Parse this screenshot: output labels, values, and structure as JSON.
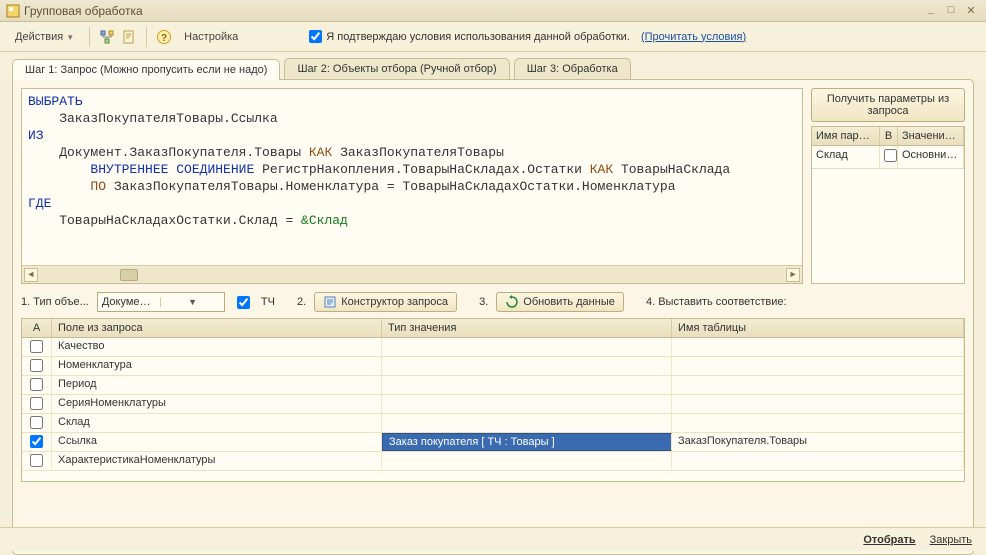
{
  "window": {
    "title": "Групповая обработка"
  },
  "toolbar": {
    "actions_label": "Действия",
    "settings_label": "Настройка",
    "confirm_label": "Я подтверждаю условия использования данной обработки.",
    "confirm_link": "(Прочитать условия)",
    "confirm_checked": true
  },
  "tabs": [
    {
      "label": "Шаг 1: Запрос (Можно пропусить если не надо)",
      "active": true
    },
    {
      "label": "Шаг 2: Объекты отбора (Ручной отбор)",
      "active": false
    },
    {
      "label": "Шаг 3: Обработка",
      "active": false
    }
  ],
  "query": {
    "tokens": [
      [
        {
          "t": "ВЫБРАТЬ",
          "c": "blue"
        }
      ],
      [
        {
          "t": "    ЗаказПокупателяТовары.Ссылка",
          "c": ""
        }
      ],
      [
        {
          "t": "ИЗ",
          "c": "blue"
        }
      ],
      [
        {
          "t": "    Документ.ЗаказПокупателя.Товары ",
          "c": ""
        },
        {
          "t": "КАК",
          "c": "brown"
        },
        {
          "t": " ЗаказПокупателяТовары",
          "c": ""
        }
      ],
      [
        {
          "t": "        ",
          "c": ""
        },
        {
          "t": "ВНУТРЕННЕЕ",
          "c": "blue"
        },
        {
          "t": " ",
          "c": ""
        },
        {
          "t": "СОЕДИНЕНИЕ",
          "c": "blue"
        },
        {
          "t": " РегистрНакопления.ТоварыНаСкладах.Остатки ",
          "c": ""
        },
        {
          "t": "КАК",
          "c": "brown"
        },
        {
          "t": " ТоварыНаСклада",
          "c": ""
        }
      ],
      [
        {
          "t": "        ",
          "c": ""
        },
        {
          "t": "ПО",
          "c": "brown"
        },
        {
          "t": " ЗаказПокупателяТовары.Номенклатура = ТоварыНаСкладахОстатки.Номенклатура",
          "c": ""
        }
      ],
      [
        {
          "t": "ГДЕ",
          "c": "blue"
        }
      ],
      [
        {
          "t": "    ТоварыНаСкладахОстатки.Склад = ",
          "c": ""
        },
        {
          "t": "&Склад",
          "c": "green"
        }
      ]
    ]
  },
  "params": {
    "button_label": "Получить параметры из запроса",
    "headers": {
      "name": "Имя парамет...",
      "b": "В",
      "value": "Значение ..."
    },
    "rows": [
      {
        "name": "Склад",
        "b": false,
        "value": "Основний ..."
      }
    ]
  },
  "mid": {
    "type_label": "1. Тип объе...",
    "type_value": "Документы",
    "tch_checked": true,
    "tch_label": "ТЧ",
    "step2_label": "2.",
    "constructor_label": "Конструктор запроса",
    "step3_label": "3.",
    "refresh_label": "Обновить данные",
    "step4_label": "4. Выставить соответствие:"
  },
  "cols": {
    "a": "A",
    "field": "Поле из запроса",
    "type": "Тип значения",
    "table": "Имя таблицы"
  },
  "rows": [
    {
      "a": false,
      "field": "Качество",
      "type": "",
      "table": ""
    },
    {
      "a": false,
      "field": "Номенклатура",
      "type": "",
      "table": ""
    },
    {
      "a": false,
      "field": "Период",
      "type": "",
      "table": ""
    },
    {
      "a": false,
      "field": "СерияНоменклатуры",
      "type": "",
      "table": ""
    },
    {
      "a": false,
      "field": "Склад",
      "type": "",
      "table": ""
    },
    {
      "a": true,
      "field": "Ссылка",
      "type": "Заказ покупателя [ ТЧ : Товары ]",
      "table": "ЗаказПокупателя.Товары",
      "selected": true
    },
    {
      "a": false,
      "field": "ХарактеристикаНоменклатуры",
      "type": "",
      "table": ""
    }
  ],
  "footer": {
    "select_label": "Отобрать",
    "close_label": "Закрыть"
  }
}
